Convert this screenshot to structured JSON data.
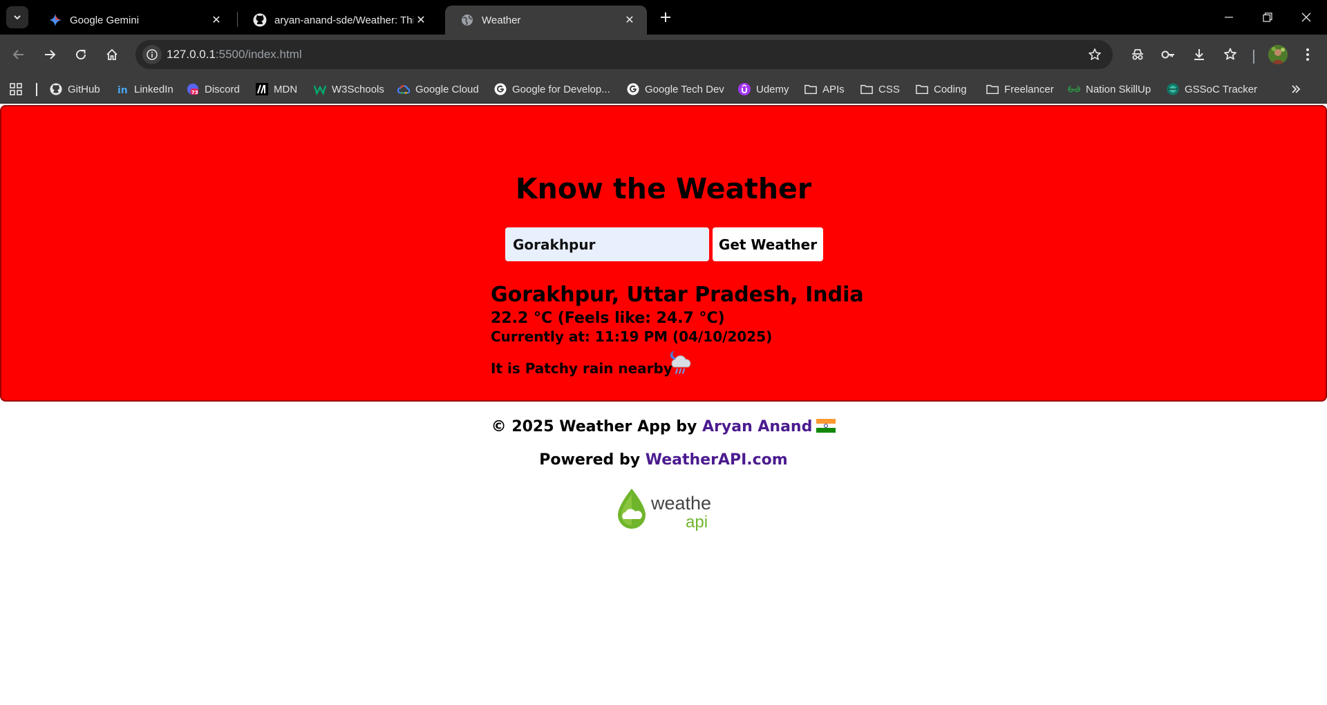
{
  "browser": {
    "tabs": [
      {
        "title": "Google Gemini",
        "icon": "gemini-icon",
        "active": false
      },
      {
        "title": "aryan-anand-sde/Weather: This",
        "icon": "github-icon",
        "active": false
      },
      {
        "title": "Weather",
        "icon": "globe-icon",
        "active": true
      }
    ],
    "url_host": "127.0.0.1",
    "url_path": ":5500/index.html",
    "bookmarks": [
      {
        "label": "GitHub",
        "icon": "github-icon"
      },
      {
        "label": "LinkedIn",
        "icon": "linkedin-icon"
      },
      {
        "label": "Discord",
        "icon": "discord-icon",
        "badge": "73"
      },
      {
        "label": "MDN",
        "icon": "mdn-icon"
      },
      {
        "label": "W3Schools",
        "icon": "w3schools-icon"
      },
      {
        "label": "Google Cloud",
        "icon": "google-cloud-icon"
      },
      {
        "label": "Google for Develop...",
        "icon": "google-icon"
      },
      {
        "label": "Google Tech Dev",
        "icon": "google-icon"
      },
      {
        "label": "Udemy",
        "icon": "udemy-icon"
      },
      {
        "label": "APIs",
        "icon": "folder-icon"
      },
      {
        "label": "CSS",
        "icon": "folder-icon"
      },
      {
        "label": "Coding",
        "icon": "folder-icon"
      },
      {
        "label": "Freelancer",
        "icon": "folder-icon"
      },
      {
        "label": "Nation SkillUp",
        "icon": "geeksforgeeks-icon"
      },
      {
        "label": "GSSoC Tracker",
        "icon": "gssoc-icon"
      }
    ]
  },
  "page": {
    "title": "Know the Weather",
    "search": {
      "value": "Gorakhpur",
      "button_label": "Get Weather"
    },
    "result": {
      "location": "Gorakhpur, Uttar Pradesh, India",
      "temperature": "22.2 °C (Feels like: 24.7 °C)",
      "current_time": "Currently at: 11:19 PM (04/10/2025)",
      "condition": "It is Patchy rain nearby",
      "condition_icon": "patchy-rain-night-icon"
    },
    "footer": {
      "credit_prefix": "© 2025 Weather App by",
      "author": "Aryan Anand",
      "powered_prefix": "Powered by",
      "provider": "WeatherAPI.com",
      "logo_text_top": "weather",
      "logo_text_bottom": "api"
    }
  },
  "colors": {
    "weather_box": "#ff0000",
    "link": "#4b1b8f",
    "browser_dark": "#3c3c3c"
  }
}
